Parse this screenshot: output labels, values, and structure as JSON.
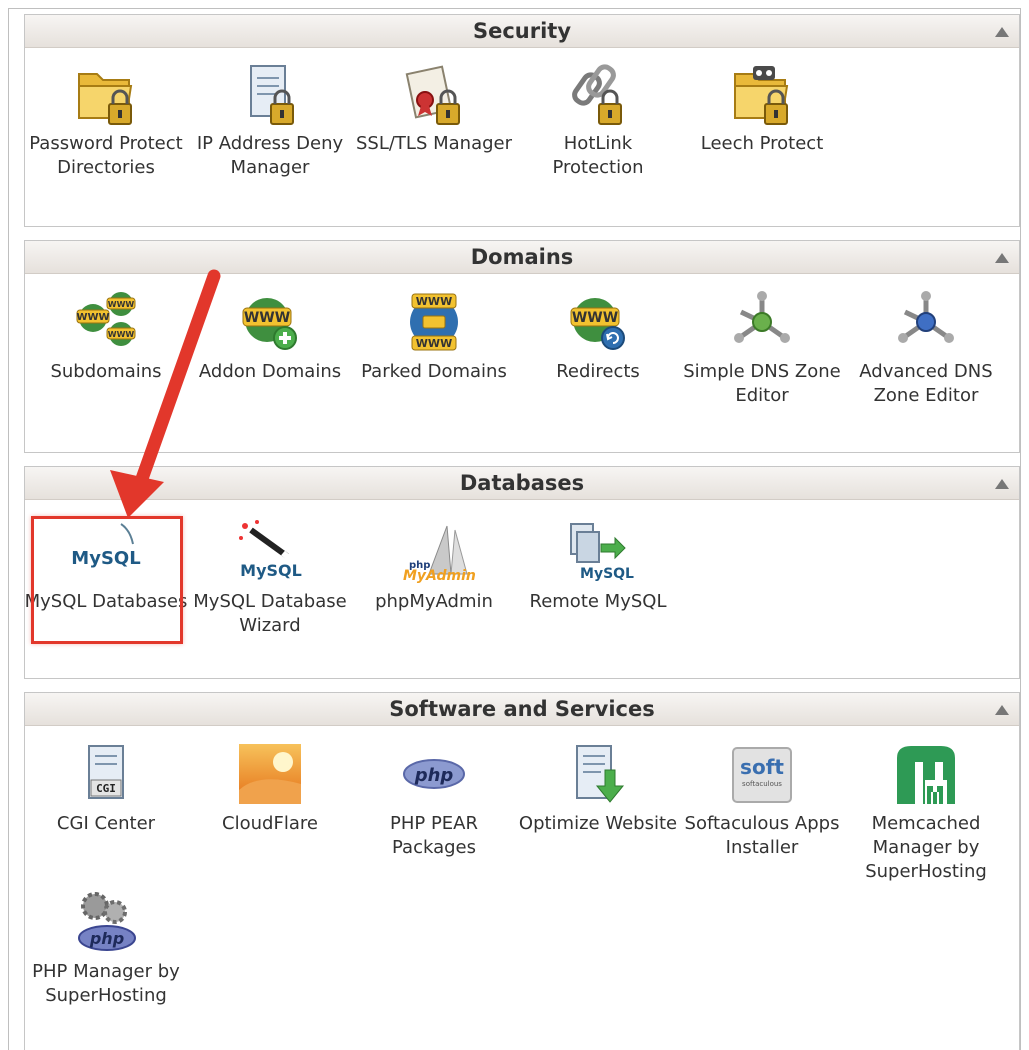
{
  "sections": [
    {
      "title": "Security",
      "items": [
        {
          "label": "Password Protect Directories",
          "icon": "folder-lock-icon"
        },
        {
          "label": "IP Address Deny Manager",
          "icon": "document-lock-icon"
        },
        {
          "label": "SSL/TLS Manager",
          "icon": "certificate-lock-icon"
        },
        {
          "label": "HotLink Protection",
          "icon": "chain-lock-icon"
        },
        {
          "label": "Leech Protect",
          "icon": "folder-eyes-lock-icon"
        }
      ]
    },
    {
      "title": "Domains",
      "items": [
        {
          "label": "Subdomains",
          "icon": "www-multiple-icon"
        },
        {
          "label": "Addon Domains",
          "icon": "www-add-icon"
        },
        {
          "label": "Parked Domains",
          "icon": "www-parked-icon"
        },
        {
          "label": "Redirects",
          "icon": "www-redirect-icon"
        },
        {
          "label": "Simple DNS Zone Editor",
          "icon": "dns-network-icon"
        },
        {
          "label": "Advanced DNS Zone Editor",
          "icon": "dns-network-advanced-icon"
        }
      ]
    },
    {
      "title": "Databases",
      "items": [
        {
          "label": "MySQL Databases",
          "icon": "mysql-icon"
        },
        {
          "label": "MySQL Database Wizard",
          "icon": "mysql-wizard-icon"
        },
        {
          "label": "phpMyAdmin",
          "icon": "phpmyadmin-icon"
        },
        {
          "label": "Remote MySQL",
          "icon": "remote-mysql-icon"
        }
      ]
    },
    {
      "title": "Software and Services",
      "items": [
        {
          "label": "CGI Center",
          "icon": "cgi-icon"
        },
        {
          "label": "CloudFlare",
          "icon": "cloudflare-icon"
        },
        {
          "label": "PHP PEAR Packages",
          "icon": "php-icon"
        },
        {
          "label": "Optimize Website",
          "icon": "optimize-icon"
        },
        {
          "label": "Softaculous Apps Installer",
          "icon": "softaculous-icon"
        },
        {
          "label": "Memcached Manager by SuperHosting",
          "icon": "memcached-icon"
        },
        {
          "label": "PHP Manager by SuperHosting",
          "icon": "php-gears-icon"
        }
      ]
    }
  ],
  "icon_text": {
    "www": "WWW",
    "mysql": "MySQL",
    "php": "php",
    "myadmin": "MyAdmin",
    "cgi": "CGI",
    "soft": "soft",
    "softaculous": "softaculous"
  },
  "colors": {
    "highlight": "#e2372b",
    "arrow": "#e2372b",
    "header_top": "#f7f5f3",
    "header_bottom": "#e6e1dc"
  }
}
